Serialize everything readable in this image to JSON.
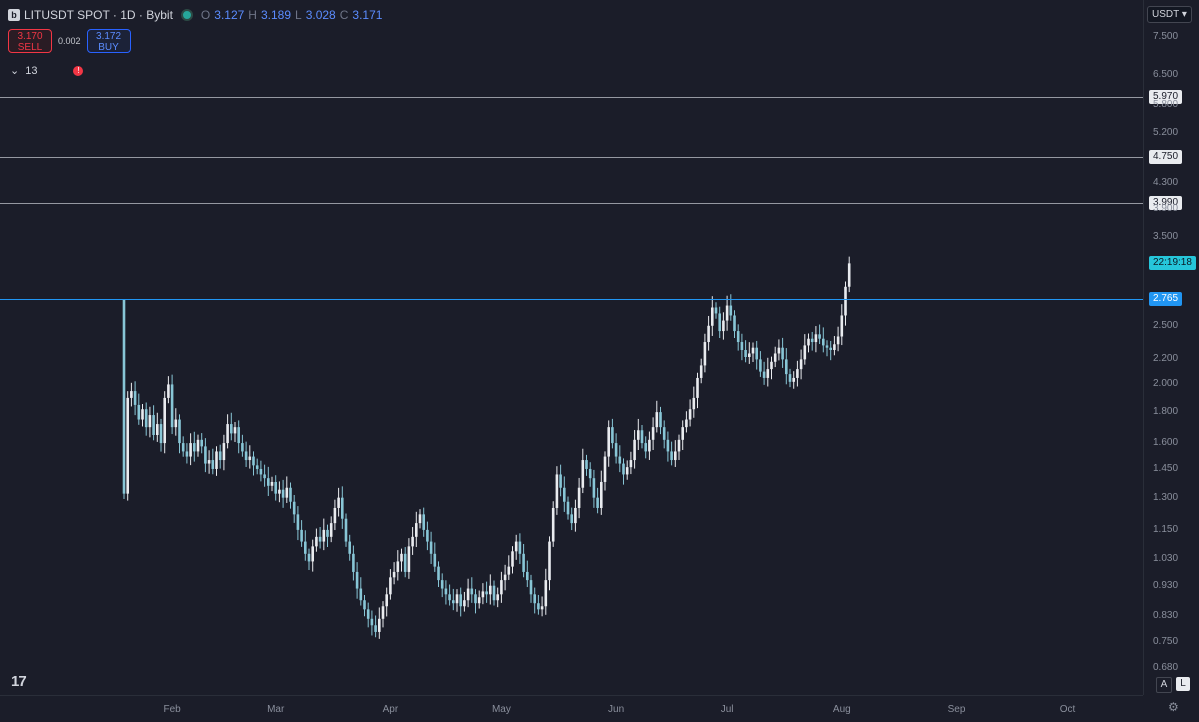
{
  "header": {
    "symbol": "LITUSDT SPOT · 1D · Bybit",
    "ohlc": [
      {
        "k": "O",
        "v": "3.127"
      },
      {
        "k": "H",
        "v": "3.189"
      },
      {
        "k": "L",
        "v": "3.028"
      },
      {
        "k": "C",
        "v": "3.171"
      }
    ]
  },
  "trade": {
    "sell_price": "3.170",
    "sell_label": "SELL",
    "spread": "0.002",
    "buy_price": "3.172",
    "buy_label": "BUY"
  },
  "indicators": {
    "count": "13",
    "toggle_icon": "chevron-down-icon",
    "warning_icon": "!"
  },
  "price_scale": {
    "currency": "USDT",
    "ticks": [
      "7.500",
      "6.500",
      "5.800",
      "5.200",
      "4.300",
      "3.900",
      "3.500",
      "2.500",
      "2.200",
      "2.000",
      "1.800",
      "1.600",
      "1.450",
      "1.300",
      "1.150",
      "1.030",
      "0.930",
      "0.830",
      "0.750",
      "0.680"
    ],
    "horizontal_lines": [
      {
        "price": "5.970",
        "style": "white"
      },
      {
        "price": "4.750",
        "style": "white"
      },
      {
        "price": "3.990",
        "style": "white"
      },
      {
        "price": "2.765",
        "style": "blue"
      }
    ],
    "countdown": "22:19:18"
  },
  "time_scale": {
    "ticks": [
      "Feb",
      "Mar",
      "Apr",
      "May",
      "Jun",
      "Jul",
      "Aug",
      "Sep",
      "Oct"
    ]
  },
  "controls": {
    "auto_label": "A",
    "log_label": "L",
    "settings_icon": "gear-icon"
  },
  "colors": {
    "background": "#1b1d29",
    "up": "#e9ebef",
    "down": "#88c6d6",
    "accent_line": "#2196f3",
    "countdown": "#26c6da"
  },
  "chart_data": {
    "type": "candlestick",
    "symbol": "LITUSDT",
    "interval": "1D",
    "scale": "log",
    "ylim": [
      0.65,
      7.9
    ],
    "note_values": "approximate daily closes read from chart",
    "start_date": "2023-01-19",
    "closes": [
      1.32,
      1.9,
      1.95,
      1.85,
      1.75,
      1.82,
      1.7,
      1.78,
      1.65,
      1.72,
      1.6,
      1.9,
      2.0,
      1.7,
      1.75,
      1.6,
      1.55,
      1.52,
      1.6,
      1.55,
      1.62,
      1.58,
      1.48,
      1.5,
      1.45,
      1.55,
      1.5,
      1.6,
      1.72,
      1.66,
      1.7,
      1.6,
      1.55,
      1.5,
      1.52,
      1.47,
      1.45,
      1.42,
      1.4,
      1.36,
      1.38,
      1.32,
      1.34,
      1.3,
      1.35,
      1.28,
      1.22,
      1.15,
      1.1,
      1.05,
      1.02,
      1.08,
      1.12,
      1.1,
      1.15,
      1.12,
      1.18,
      1.25,
      1.3,
      1.2,
      1.1,
      1.05,
      0.98,
      0.92,
      0.88,
      0.85,
      0.82,
      0.8,
      0.78,
      0.82,
      0.86,
      0.9,
      0.96,
      0.98,
      1.02,
      1.05,
      0.98,
      1.08,
      1.12,
      1.18,
      1.22,
      1.15,
      1.1,
      1.05,
      1.0,
      0.95,
      0.92,
      0.9,
      0.88,
      0.87,
      0.9,
      0.86,
      0.88,
      0.92,
      0.9,
      0.87,
      0.89,
      0.91,
      0.9,
      0.93,
      0.88,
      0.9,
      0.95,
      0.97,
      1.0,
      1.06,
      1.1,
      1.05,
      0.98,
      0.95,
      0.9,
      0.87,
      0.85,
      0.86,
      0.95,
      1.1,
      1.25,
      1.42,
      1.35,
      1.28,
      1.22,
      1.18,
      1.25,
      1.35,
      1.5,
      1.45,
      1.4,
      1.3,
      1.25,
      1.38,
      1.52,
      1.7,
      1.6,
      1.52,
      1.48,
      1.42,
      1.46,
      1.5,
      1.62,
      1.68,
      1.6,
      1.55,
      1.62,
      1.7,
      1.8,
      1.7,
      1.62,
      1.55,
      1.5,
      1.55,
      1.62,
      1.7,
      1.75,
      1.82,
      1.9,
      2.05,
      2.15,
      2.35,
      2.5,
      2.68,
      2.62,
      2.45,
      2.55,
      2.7,
      2.6,
      2.45,
      2.35,
      2.28,
      2.22,
      2.25,
      2.3,
      2.2,
      2.1,
      2.05,
      2.12,
      2.18,
      2.25,
      2.3,
      2.2,
      2.08,
      2.02,
      2.05,
      2.12,
      2.2,
      2.32,
      2.38,
      2.35,
      2.42,
      2.38,
      2.32,
      2.3,
      2.28,
      2.33,
      2.4,
      2.6,
      2.9,
      3.17
    ]
  }
}
